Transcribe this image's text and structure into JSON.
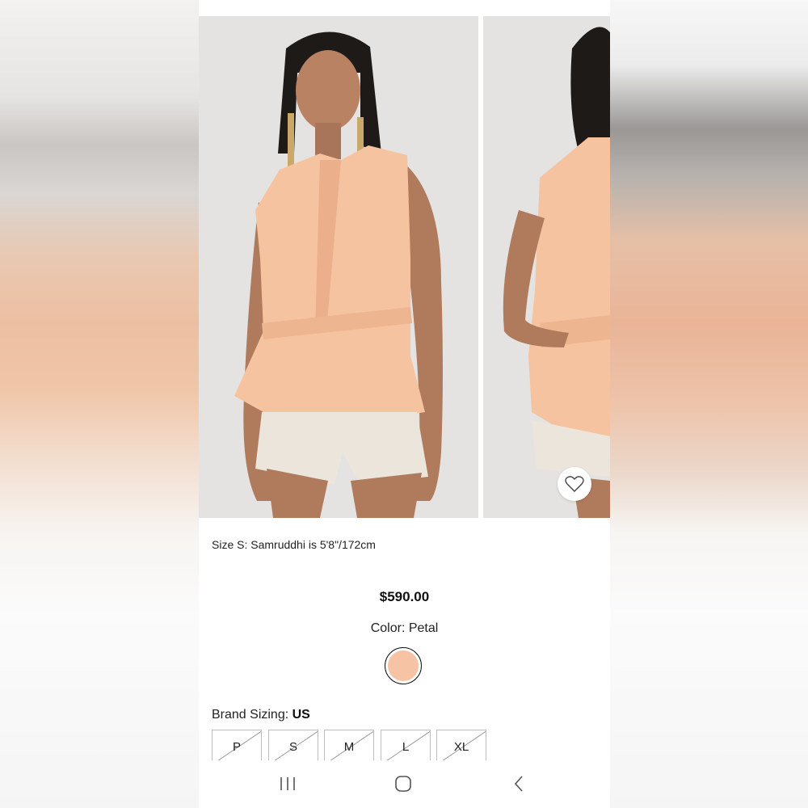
{
  "product": {
    "model_caption": "Size S: Samruddhi is 5'8\"/172cm",
    "price": "$590.00",
    "color_label": "Color: Petal",
    "color_swatch": "#f6c3a4",
    "brand_sizing_label": "Brand Sizing: ",
    "brand_sizing_value": "US",
    "sizes": [
      {
        "label": "P",
        "available": false
      },
      {
        "label": "S",
        "available": false
      },
      {
        "label": "M",
        "available": false
      },
      {
        "label": "L",
        "available": false
      },
      {
        "label": "XL",
        "available": false
      }
    ]
  },
  "icons": {
    "wishlist": "heart-icon",
    "nav_recents": "recents-icon",
    "nav_home": "home-icon",
    "nav_back": "back-icon"
  },
  "colors": {
    "garment": "#f6c3a0",
    "photo_background": "#e4e3e1",
    "text": "#222222"
  }
}
